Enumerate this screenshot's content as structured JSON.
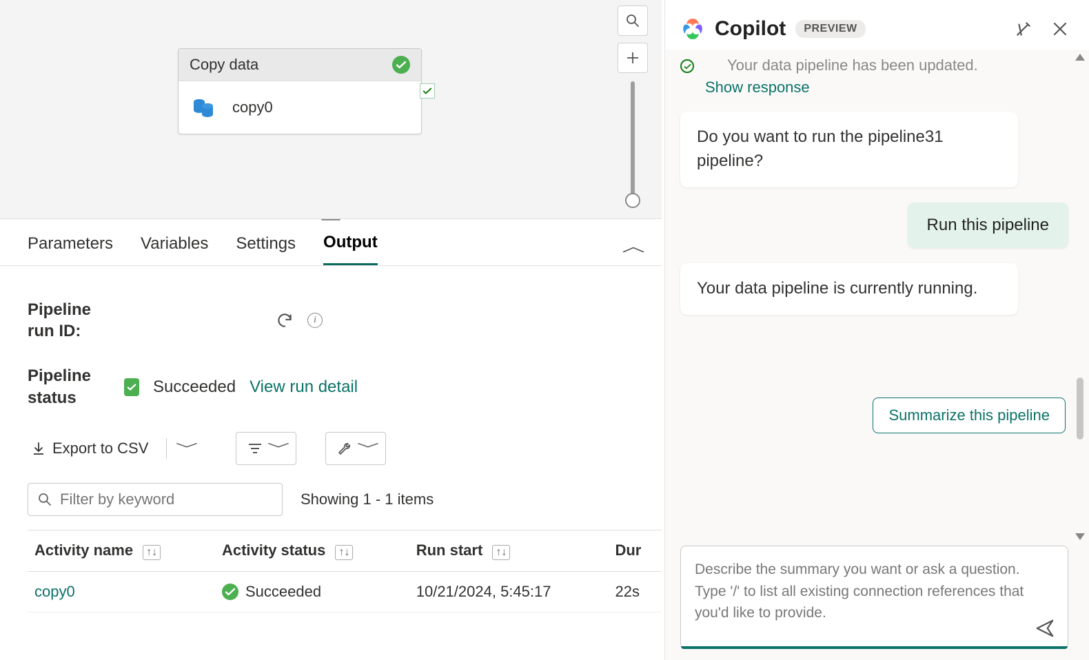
{
  "canvas": {
    "activity_title": "Copy data",
    "activity_name": "copy0"
  },
  "tabs": {
    "items": [
      "Parameters",
      "Variables",
      "Settings",
      "Output"
    ],
    "active": "Output"
  },
  "output": {
    "run_id_label": "Pipeline run ID:",
    "status_label": "Pipeline status",
    "status_value": "Succeeded",
    "view_detail": "View run detail",
    "export_label": "Export to CSV",
    "filter_placeholder": "Filter by keyword",
    "showing": "Showing 1 - 1 items",
    "columns": {
      "activity_name": "Activity name",
      "activity_status": "Activity status",
      "run_start": "Run start",
      "duration": "Dur"
    },
    "rows": [
      {
        "name": "copy0",
        "status": "Succeeded",
        "run_start": "10/21/2024, 5:45:17",
        "duration": "22s"
      }
    ]
  },
  "copilot": {
    "title": "Copilot",
    "badge": "PREVIEW",
    "clipped_msg": "Your data pipeline has been updated.",
    "show_response": "Show response",
    "bot_q": "Do you want to run the pipeline31 pipeline?",
    "user_msg": "Run this pipeline",
    "bot_running": "Your data pipeline is currently running.",
    "suggestion": "Summarize this pipeline",
    "composer_placeholder": "Describe the summary you want or ask a question.\nType '/' to list all existing connection references that you'd like to provide."
  }
}
